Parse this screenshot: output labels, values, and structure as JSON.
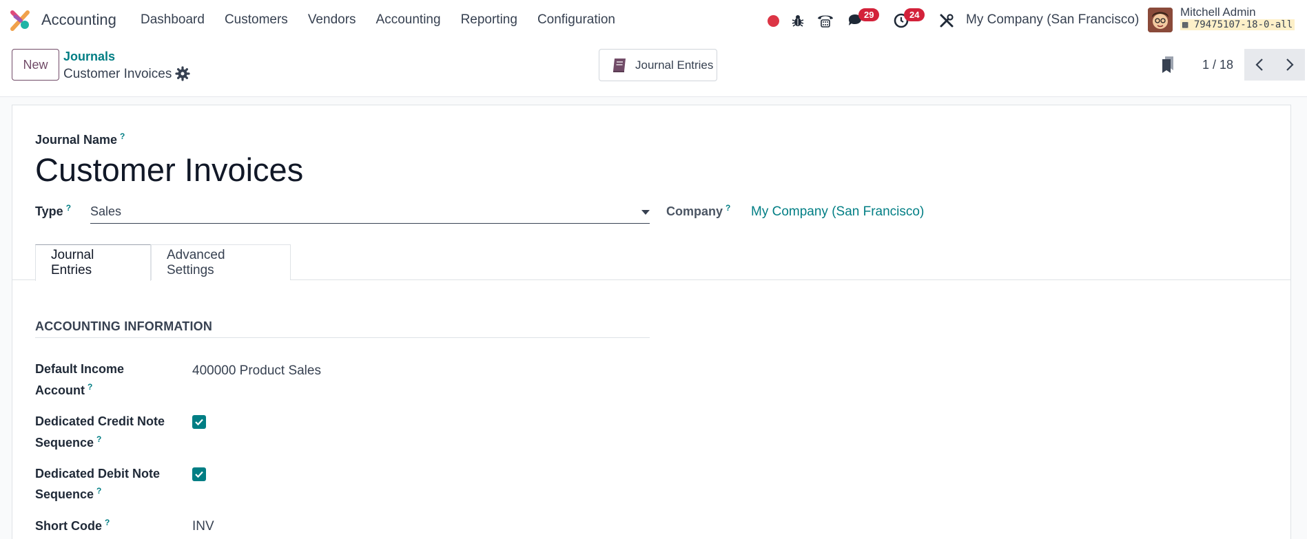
{
  "navbar": {
    "app_name": "Accounting",
    "menu": [
      "Dashboard",
      "Customers",
      "Vendors",
      "Accounting",
      "Reporting",
      "Configuration"
    ],
    "messages_count": "29",
    "activities_count": "24",
    "company": "My Company (San Francisco)",
    "user_name": "Mitchell Admin",
    "database": "79475107-18-0-all"
  },
  "control": {
    "new_label": "New",
    "breadcrumb_parent": "Journals",
    "breadcrumb_current": "Customer Invoices",
    "smart_button_label": "Journal Entries",
    "pager": "1 / 18"
  },
  "form": {
    "journal_name_label": "Journal Name",
    "journal_name": "Customer Invoices",
    "type_label": "Type",
    "type_value": "Sales",
    "company_label": "Company",
    "company_value": "My Company (San Francisco)",
    "help_mark": "?",
    "tabs": [
      "Journal Entries",
      "Advanced Settings"
    ],
    "section_title": "ACCOUNTING INFORMATION",
    "fields": {
      "income_label_1": "Default Income",
      "income_label_2": "Account",
      "income_value": "400000 Product Sales",
      "credit_label_1": "Dedicated Credit Note",
      "credit_label_2": "Sequence",
      "credit_checked": true,
      "debit_label_1": "Dedicated Debit Note",
      "debit_label_2": "Sequence",
      "debit_checked": true,
      "short_code_label": "Short Code",
      "short_code_value": "INV"
    }
  },
  "colors": {
    "brand": "#714b67",
    "accent": "#017e84",
    "badge": "#d3223a"
  }
}
